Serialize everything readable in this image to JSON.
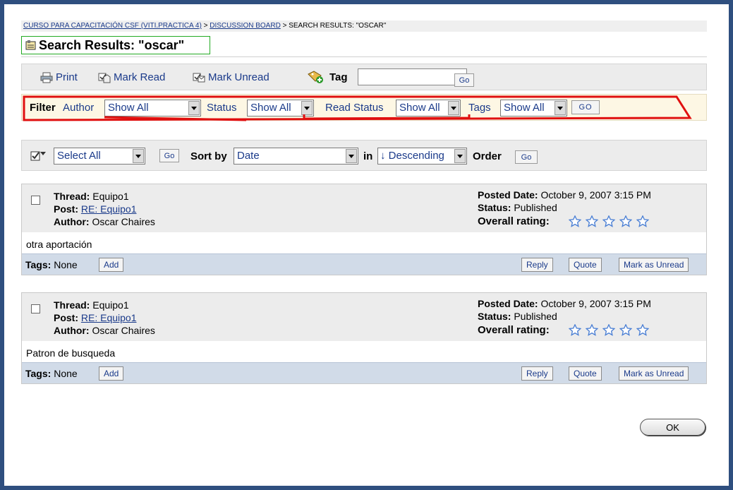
{
  "breadcrumb": {
    "course": "CURSO PARA CAPACITACIÓN CSF (VITI.PRACTICA 4)",
    "sep1": ">",
    "board": "DISCUSSION BOARD",
    "sep2": "> SEARCH RESULTS: \"OSCAR\""
  },
  "page_title": "Search Results: \"oscar\"",
  "toolbar": {
    "print": "Print",
    "mark_read": "Mark Read",
    "mark_unread": "Mark Unread",
    "tag_label": "Tag",
    "tag_value": "",
    "go": "Go"
  },
  "filter": {
    "filter_label": "Filter",
    "author_label": "Author",
    "author_value": "Show All",
    "status_label": "Status",
    "status_value": "Show All",
    "read_status_label": "Read Status",
    "read_status_value": "Show All",
    "tags_label": "Tags",
    "tags_value": "Show All",
    "go": "GO",
    "highlight_color": "#e01010"
  },
  "sort": {
    "select_value": "Select All",
    "go1": "Go",
    "sort_by_label": "Sort by",
    "sort_value": "Date",
    "in_label": "in",
    "order_value": "↓ Descending",
    "order_label": "Order",
    "go2": "Go"
  },
  "posts": [
    {
      "thread_label": "Thread:",
      "thread": "Equipo1",
      "post_label": "Post:",
      "post": "RE: Equipo1",
      "author_label": "Author:",
      "author": "Oscar Chaires",
      "date_label": "Posted Date:",
      "date": "October 9, 2007 3:15 PM",
      "status_label": "Status:",
      "status": "Published",
      "rating_label": "Overall rating:",
      "rating": 0,
      "body": "otra aportación",
      "tags_label": "Tags:",
      "tags": "None",
      "add": "Add",
      "reply": "Reply",
      "quote": "Quote",
      "mark_unread": "Mark as Unread"
    },
    {
      "thread_label": "Thread:",
      "thread": "Equipo1",
      "post_label": "Post:",
      "post": "RE: Equipo1",
      "author_label": "Author:",
      "author": "Oscar Chaires",
      "date_label": "Posted Date:",
      "date": "October 9, 2007 3:15 PM",
      "status_label": "Status:",
      "status": "Published",
      "rating_label": "Overall rating:",
      "rating": 0,
      "body": "Patron de busqueda",
      "tags_label": "Tags:",
      "tags": "None",
      "add": "Add",
      "reply": "Reply",
      "quote": "Quote",
      "mark_unread": "Mark as Unread"
    }
  ],
  "ok_button": "OK",
  "colors": {
    "frame": "#2f4f7f",
    "link": "#1a3a8a",
    "post_footer": "#d1dbe8",
    "star": "#4a7fd4"
  }
}
